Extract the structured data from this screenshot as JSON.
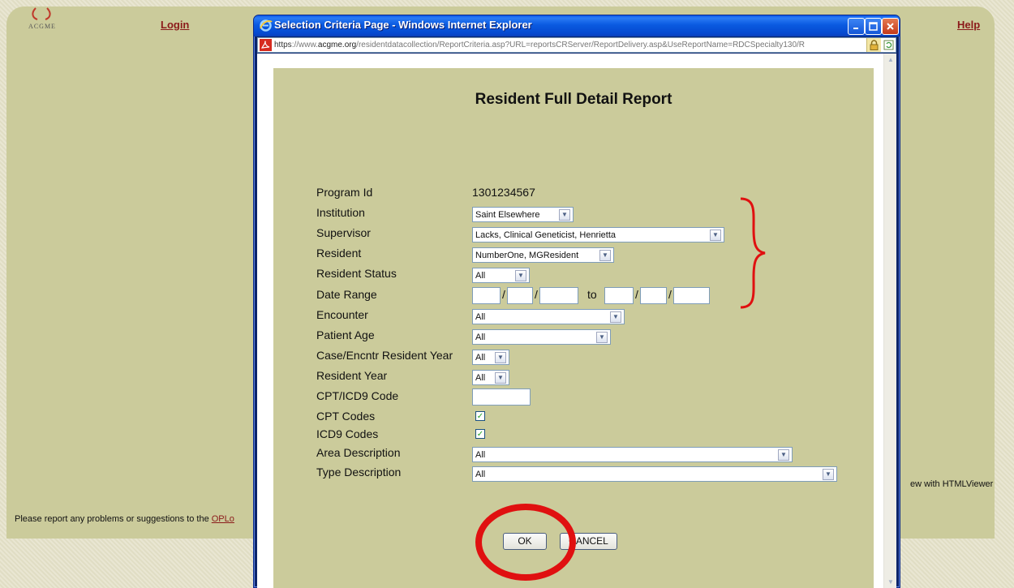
{
  "background": {
    "logo_text": "ACGME",
    "login_label": "Login",
    "help_label": "Help",
    "footer_text": "Please report any problems or suggestions to the ",
    "footer_link": "OPLo",
    "viewer_text": "ew with HTMLViewer"
  },
  "window": {
    "title": "Selection Criteria Page - Windows Internet Explorer",
    "address_https": "https",
    "address_prefix": "://www.",
    "address_domain": "acgme.org",
    "address_path": "/residentdatacollection/ReportCriteria.asp?URL=reportsCRServer/ReportDelivery.asp&UseReportName=RDCSpecialty130/R"
  },
  "report": {
    "title": "Resident Full Detail Report",
    "labels": {
      "program_id": "Program Id",
      "institution": "Institution",
      "supervisor": "Supervisor",
      "resident": "Resident",
      "resident_status": "Resident Status",
      "date_range": "Date Range",
      "encounter": "Encounter",
      "patient_age": "Patient Age",
      "case_encntr_resident_year": "Case/Encntr Resident Year",
      "resident_year": "Resident Year",
      "cpt_icd9_code": "CPT/ICD9 Code",
      "cpt_codes": "CPT Codes",
      "icd9_codes": "ICD9 Codes",
      "area_description": "Area Description",
      "type_description": "Type Description"
    },
    "values": {
      "program_id": "1301234567",
      "institution": "Saint Elsewhere",
      "supervisor": "Lacks, Clinical Geneticist, Henrietta",
      "resident": "NumberOne, MGResident",
      "resident_status": "All",
      "date_to": "to",
      "date_separator": "/",
      "encounter": "All",
      "patient_age": "All",
      "case_encntr_resident_year": "All",
      "resident_year": "All",
      "cpt_icd9_code": "",
      "cpt_codes_checked": "✓",
      "icd9_codes_checked": "✓",
      "area_description": "All",
      "type_description": "All"
    },
    "ok_label": "OK",
    "cancel_label": "CANCEL"
  },
  "colors": {
    "panel_bg": "#cbcb9b",
    "highlight_red": "#e01010",
    "link_red": "#8b1a1a",
    "titlebar_blue": "#0a5ae0"
  }
}
